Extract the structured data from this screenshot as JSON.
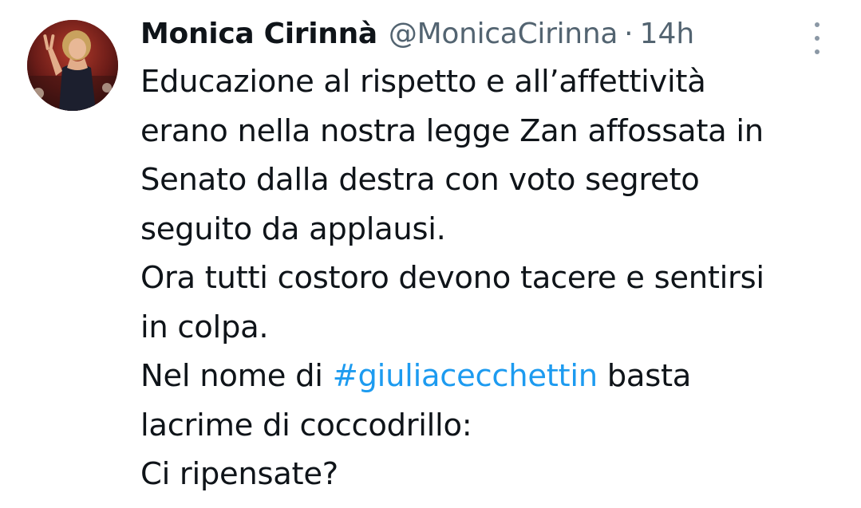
{
  "tweet": {
    "author": {
      "display_name": "Monica Cirinnà",
      "handle": "@MonicaCirinna",
      "separator": "·",
      "time": "14h",
      "avatar_icon": "profile-photo"
    },
    "more_icon": "vertical-ellipsis-icon",
    "lines": [
      {
        "text": "Educazione al rispetto e all’affettività"
      },
      {
        "text": "erano nella nostra legge Zan affossata in"
      },
      {
        "text": "Senato dalla destra con voto segreto"
      },
      {
        "text": "seguito da applausi."
      },
      {
        "text": "Ora tutti costoro devono tacere e sentirsi"
      },
      {
        "text": "in colpa."
      },
      {
        "before": "Nel nome di ",
        "hashtag": "#giuliacecchettin",
        "after": " basta"
      },
      {
        "text": "lacrime di coccodrillo:"
      },
      {
        "text": "Ci ripensate?"
      }
    ],
    "colors": {
      "text": "#0f1419",
      "secondary": "#536471",
      "link": "#1d9bf0"
    }
  }
}
